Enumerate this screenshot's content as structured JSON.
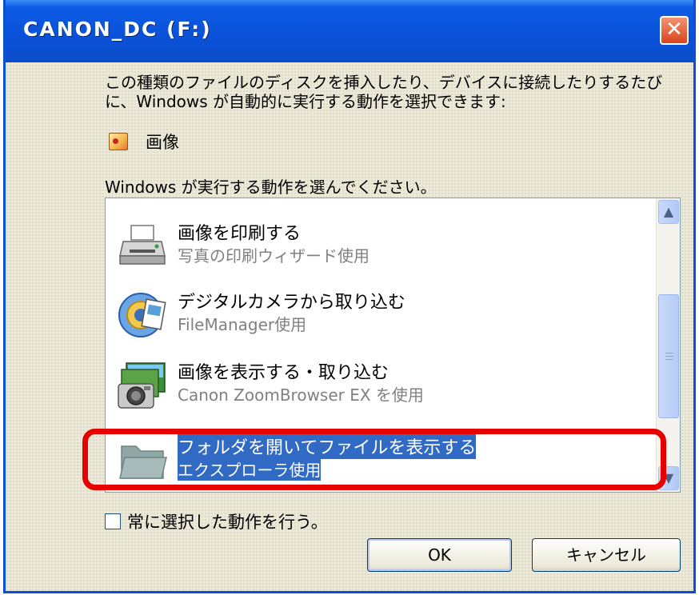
{
  "window": {
    "title": "CANON_DC (F:)",
    "close_glyph": "✕"
  },
  "description": "この種類のファイルのディスクを挿入したり、デバイスに接続したりするたびに、Windows が自動的に実行する動作を選択できます:",
  "content_type": {
    "icon": "picture-icon",
    "label": "画像"
  },
  "prompt": "Windows が実行する動作を選んでください。",
  "actions": [
    {
      "title": "画像を印刷する",
      "subtitle": "写真の印刷ウィザード使用",
      "icon": "printer-icon",
      "selected": false
    },
    {
      "title": "デジタルカメラから取り込む",
      "subtitle": "FileManager使用",
      "icon": "camera-import-icon",
      "selected": false
    },
    {
      "title": "画像を表示する・取り込む",
      "subtitle": "Canon ZoomBrowser EX を使用",
      "icon": "camera-photos-icon",
      "selected": false
    },
    {
      "title": "フォルダを開いてファイルを表示する",
      "subtitle": "エクスプローラ使用",
      "icon": "folder-icon",
      "selected": true
    }
  ],
  "checkbox": {
    "label": "常に選択した動作を行う。",
    "checked": false
  },
  "buttons": {
    "ok": "OK",
    "cancel": "キャンセル"
  },
  "colors": {
    "titlebar": "#0a51d8",
    "selection": "#316ac5",
    "highlight_box": "#e60000"
  }
}
